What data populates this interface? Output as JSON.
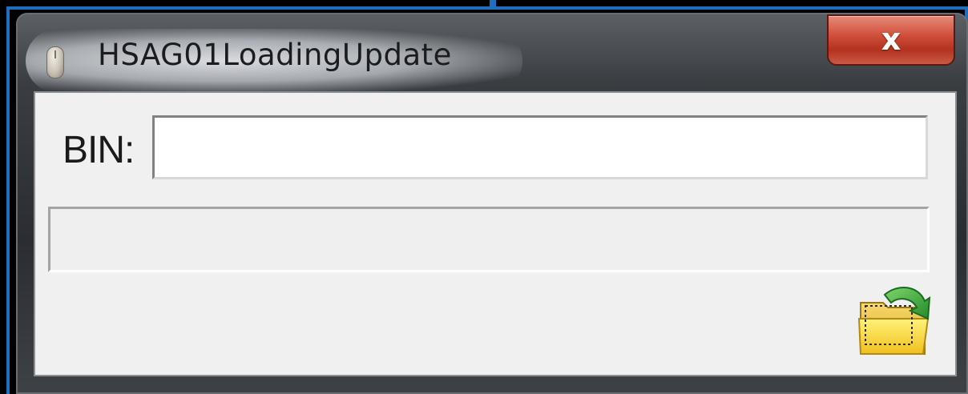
{
  "window": {
    "title": "HSAG01LoadingUpdate",
    "close_label": "x"
  },
  "form": {
    "bin_label": "BIN:",
    "bin_value": "",
    "status_text": ""
  },
  "icons": {
    "app": "app-icon",
    "open_folder": "open-folder-icon"
  },
  "colors": {
    "selection_frame": "#1e6fc0",
    "close_button": "#c43c28",
    "client_background": "#f0f0f0"
  }
}
